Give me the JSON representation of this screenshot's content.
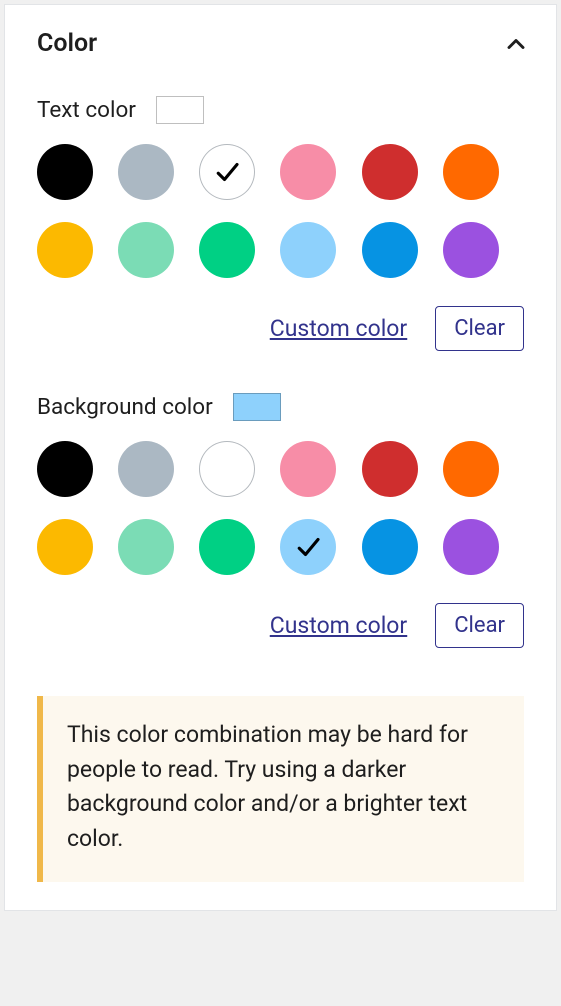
{
  "panel": {
    "title": "Color"
  },
  "text_color": {
    "label": "Text color",
    "indicator": "#ffffff",
    "selected_index": 2,
    "swatches": [
      {
        "hex": "#000000",
        "border": false
      },
      {
        "hex": "#abb8c3",
        "border": false
      },
      {
        "hex": "#ffffff",
        "border": true
      },
      {
        "hex": "#f78da7",
        "border": false
      },
      {
        "hex": "#cf2e2e",
        "border": false
      },
      {
        "hex": "#ff6900",
        "border": false
      },
      {
        "hex": "#fcb900",
        "border": false
      },
      {
        "hex": "#7bdcb5",
        "border": false
      },
      {
        "hex": "#00d084",
        "border": false
      },
      {
        "hex": "#8ed1fc",
        "border": false
      },
      {
        "hex": "#0693e3",
        "border": false
      },
      {
        "hex": "#9b51e0",
        "border": false
      }
    ],
    "custom_label": "Custom color",
    "clear_label": "Clear"
  },
  "background_color": {
    "label": "Background color",
    "indicator": "#8ed1fc",
    "selected_index": 9,
    "swatches": [
      {
        "hex": "#000000",
        "border": false
      },
      {
        "hex": "#abb8c3",
        "border": false
      },
      {
        "hex": "#ffffff",
        "border": true
      },
      {
        "hex": "#f78da7",
        "border": false
      },
      {
        "hex": "#cf2e2e",
        "border": false
      },
      {
        "hex": "#ff6900",
        "border": false
      },
      {
        "hex": "#fcb900",
        "border": false
      },
      {
        "hex": "#7bdcb5",
        "border": false
      },
      {
        "hex": "#00d084",
        "border": false
      },
      {
        "hex": "#8ed1fc",
        "border": false
      },
      {
        "hex": "#0693e3",
        "border": false
      },
      {
        "hex": "#9b51e0",
        "border": false
      }
    ],
    "custom_label": "Custom color",
    "clear_label": "Clear"
  },
  "notice": {
    "text": "This color combination may be hard for people to read. Try using a darker background color and/or a brighter text color."
  }
}
